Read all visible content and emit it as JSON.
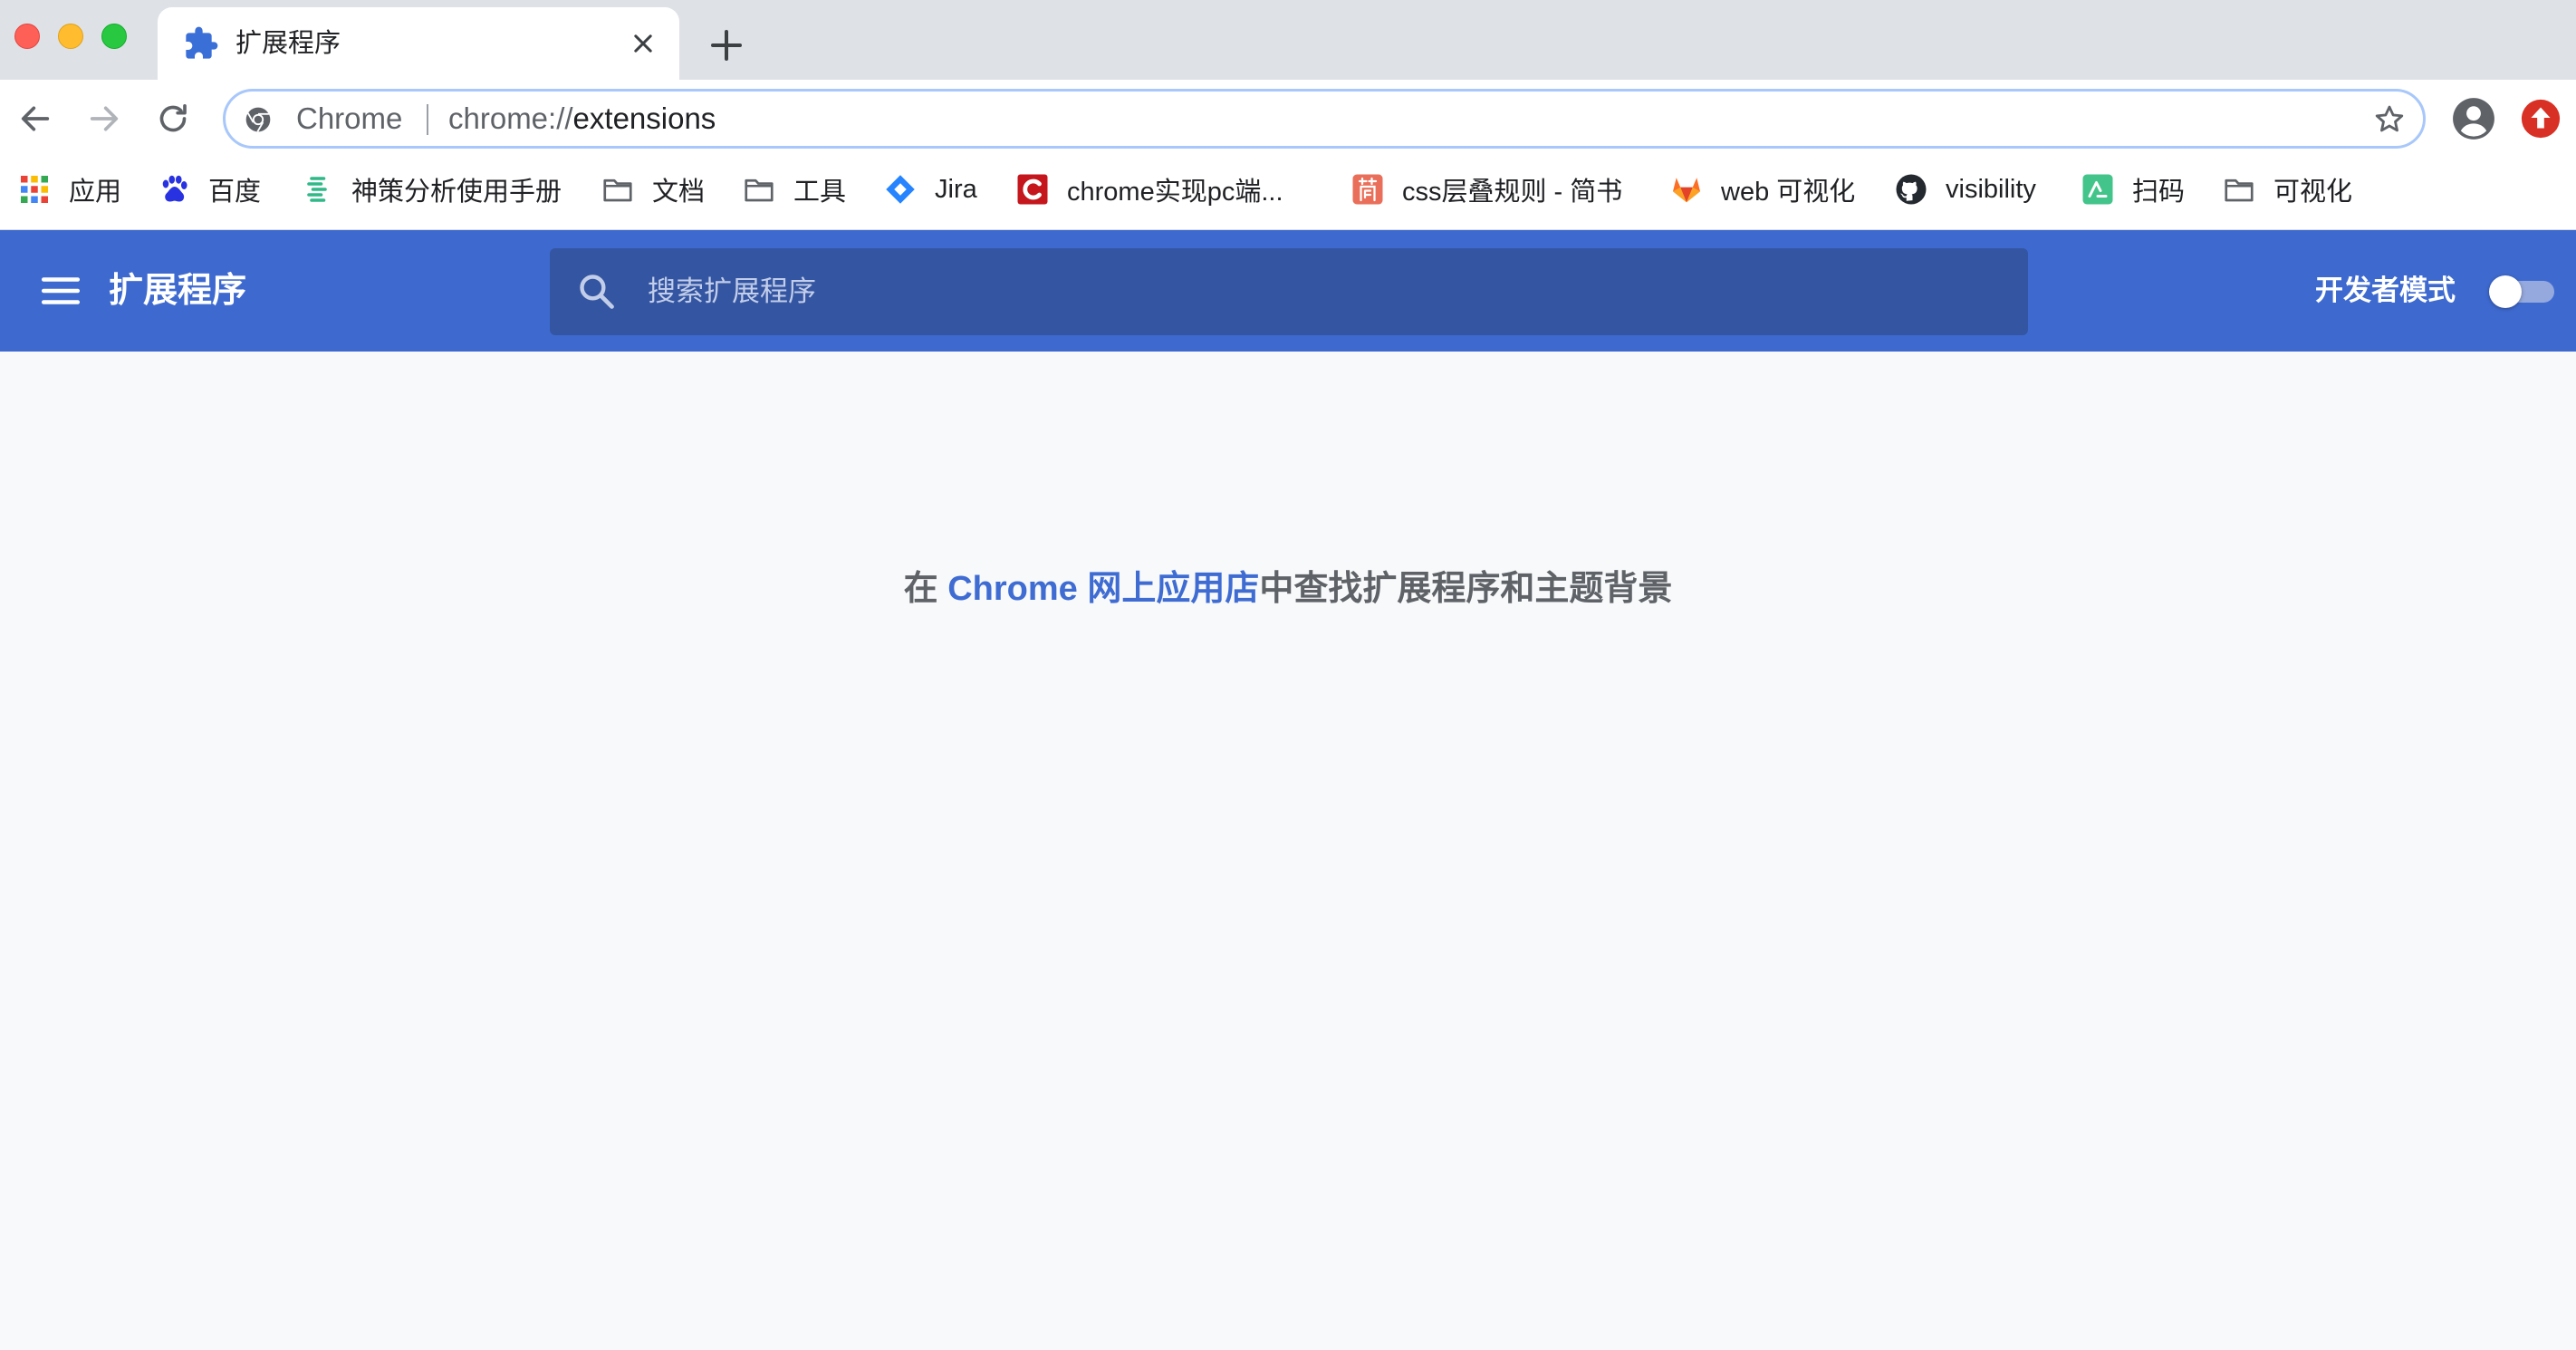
{
  "window": {
    "tab": {
      "title": "扩展程序",
      "icon": "puzzle-piece-icon"
    }
  },
  "toolbar": {
    "omnibox": {
      "chip": "Chrome",
      "url_scheme": "chrome://",
      "url_path": "extensions"
    }
  },
  "bookmarks": [
    {
      "label": "应用",
      "icon": "apps-grid-icon"
    },
    {
      "label": "百度",
      "icon": "baidu-paw-icon"
    },
    {
      "label": "神策分析使用手册",
      "icon": "sensors-icon"
    },
    {
      "label": "文档",
      "icon": "folder-icon"
    },
    {
      "label": "工具",
      "icon": "folder-icon"
    },
    {
      "label": "Jira",
      "icon": "jira-icon"
    },
    {
      "label": "chrome实现pc端...",
      "icon": "c-logo-icon"
    },
    {
      "label": "css层叠规则 - 简书",
      "icon": "jianshu-icon"
    },
    {
      "label": "web 可视化",
      "icon": "gitlab-icon"
    },
    {
      "label": "visibility",
      "icon": "github-icon"
    },
    {
      "label": "扫码",
      "icon": "scan-app-icon"
    },
    {
      "label": "可视化",
      "icon": "folder-icon"
    }
  ],
  "extensions_page": {
    "title": "扩展程序",
    "search_placeholder": "搜索扩展程序",
    "developer_mode_label": "开发者模式",
    "developer_mode_on": false,
    "empty_prefix": "在 ",
    "empty_link": "Chrome 网上应用店",
    "empty_suffix": "中查找扩展程序和主题背景"
  },
  "colors": {
    "header": "#3e6ad0",
    "search_box": "#3455a1",
    "link": "#3f6cd2",
    "page_bg": "#f8f9fa"
  }
}
